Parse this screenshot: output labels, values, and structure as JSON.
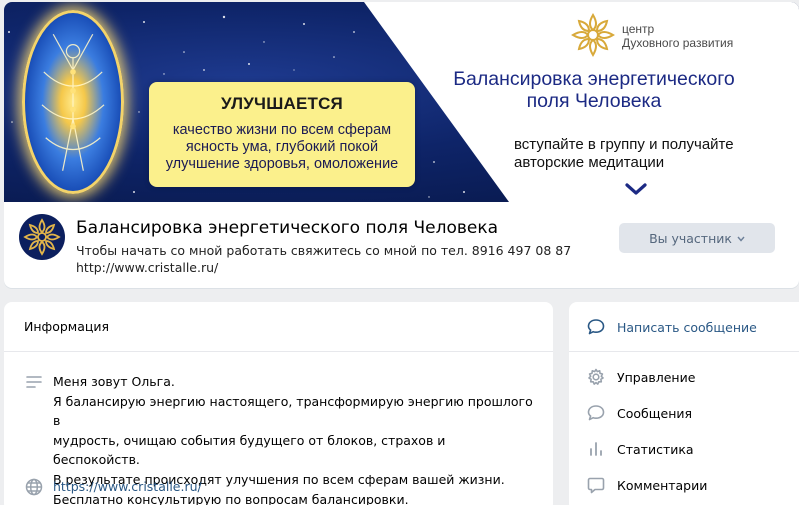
{
  "cover": {
    "highlight_title": "УЛУЧШАЕТСЯ",
    "highlight_lines": [
      "качество жизни по всем сферам",
      "ясность ума, глубокий покой",
      "улучшение здоровья, омоложение"
    ],
    "center_line1": "центр",
    "center_line2": "Духовного развития",
    "title_line1": "Балансировка энергетического",
    "title_line2": "поля Человека",
    "subtitle_line1": "вступайте в группу и получайте",
    "subtitle_line2": "авторские медитации",
    "colors": {
      "space": "#0e2468",
      "yellow": "#fbf08c",
      "title": "#1c2a84",
      "gold": "#d8a93a"
    }
  },
  "header": {
    "name": "Балансировка энергетического поля Человека",
    "status_line1": "Чтобы начать со мной работать свяжитесь со мной по тел. 8916 497 08 87",
    "status_line2": "http://www.cristalle.ru/",
    "member_button": "Вы участник"
  },
  "info": {
    "title": "Информация",
    "description": [
      "Меня зовут Ольга.",
      "Я балансирую энергию настоящего, трансформирую энергию прошлого в",
      "мудрость, очищаю события будущего от блоков, страхов и беспокойств.",
      "В результате происходят улучшения по всем сферам вашей жизни.",
      "Бесплатно консультирую по вопросам балансировки."
    ],
    "link": "https://www.cristalle.ru/",
    "description_icon": "text-lines-icon",
    "link_icon": "globe-icon"
  },
  "actions": {
    "write_message": "Написать сообщение",
    "items": [
      {
        "label": "Управление",
        "icon": "gear-icon"
      },
      {
        "label": "Сообщения",
        "icon": "message-bubble-icon"
      },
      {
        "label": "Статистика",
        "icon": "bar-chart-icon"
      },
      {
        "label": "Комментарии",
        "icon": "comment-icon"
      }
    ],
    "colors": {
      "link": "#2a5885",
      "icon": "#99a2ad"
    }
  }
}
